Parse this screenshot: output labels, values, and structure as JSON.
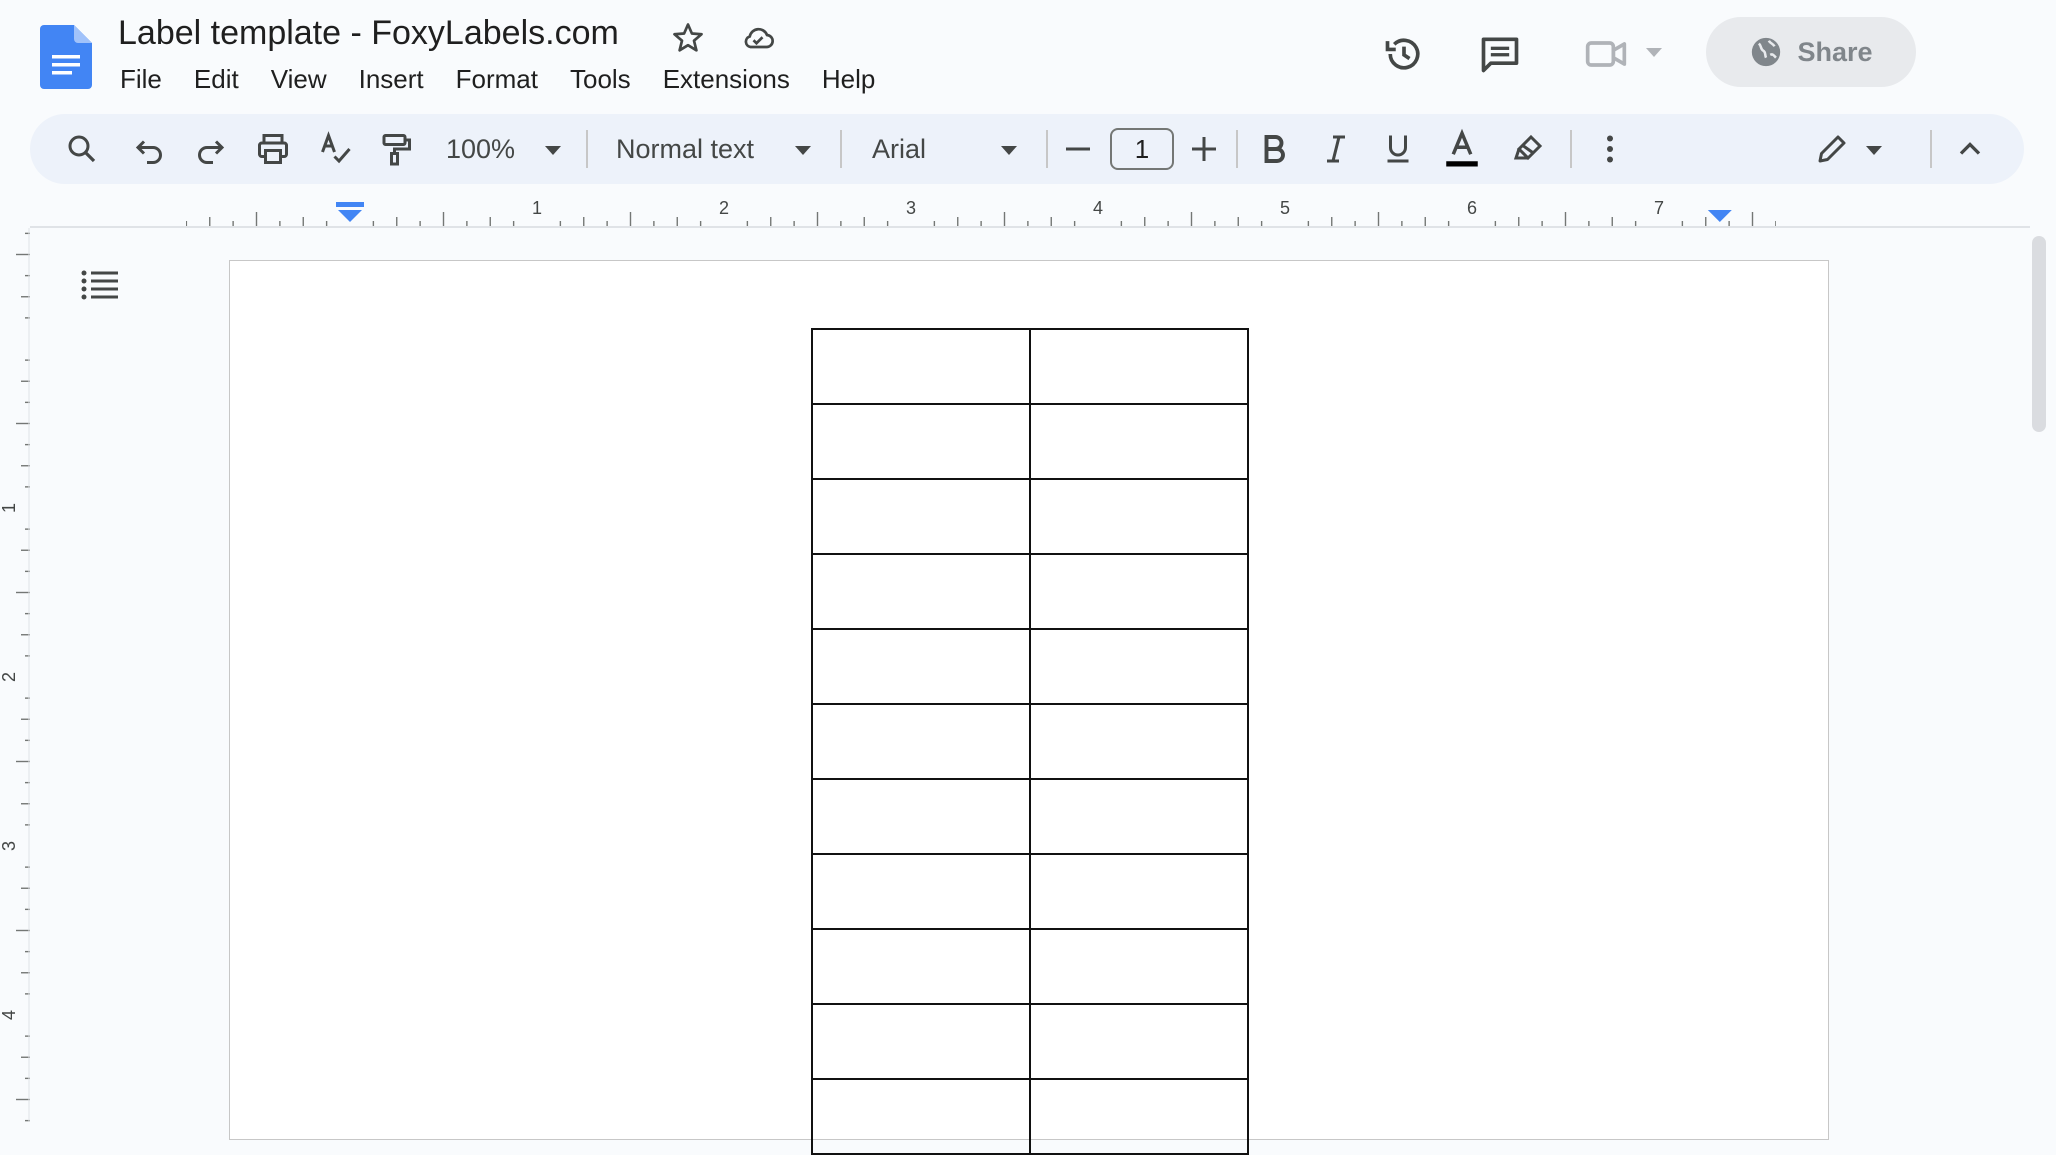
{
  "app": {
    "title": "Label template - FoxyLabels.com",
    "share_label": "Share"
  },
  "menu": [
    "File",
    "Edit",
    "View",
    "Insert",
    "Format",
    "Tools",
    "Extensions",
    "Help"
  ],
  "toolbar": {
    "zoom": "100%",
    "style": "Normal text",
    "font": "Arial",
    "font_size": "1"
  },
  "ruler": {
    "horizontal_labels": [
      "1",
      "2",
      "3",
      "4",
      "5",
      "6",
      "7"
    ],
    "vertical_labels": [
      "1",
      "2",
      "3",
      "4"
    ]
  },
  "table": {
    "columns": 2,
    "visible_rows": 11
  },
  "colors": {
    "accent": "#4285f4",
    "toolbar_bg": "#edf2fa",
    "page_bg": "#f9fbfd"
  }
}
